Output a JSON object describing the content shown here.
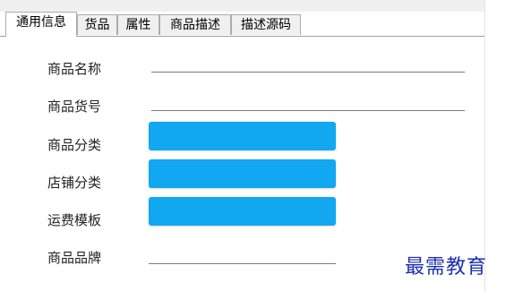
{
  "tabs": [
    {
      "label": "通用信息",
      "active": true
    },
    {
      "label": "货品",
      "active": false
    },
    {
      "label": "属性",
      "active": false
    },
    {
      "label": "商品描述",
      "active": false
    },
    {
      "label": "描述源码",
      "active": false
    }
  ],
  "form": {
    "product_name_label": "商品名称",
    "product_name_value": "",
    "product_code_label": "商品货号",
    "product_code_value": "",
    "product_category_label": "商品分类",
    "store_category_label": "店铺分类",
    "shipping_template_label": "运费模板",
    "product_brand_label": "商品品牌",
    "product_brand_value": ""
  },
  "colors": {
    "select_fill": "#11a7f1",
    "watermark": "#1d2fb0"
  },
  "watermark": "最需教育"
}
